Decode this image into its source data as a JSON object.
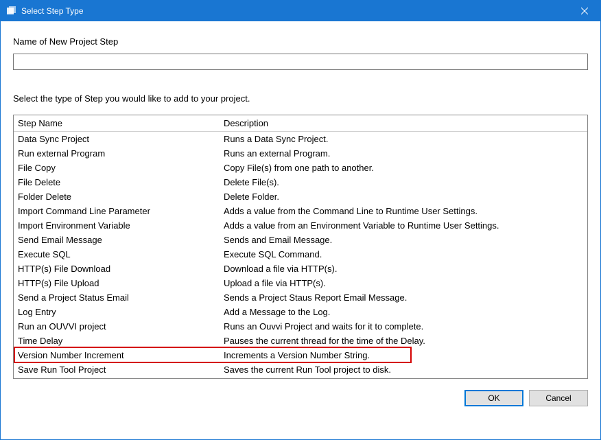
{
  "window": {
    "title": "Select Step Type"
  },
  "form": {
    "name_label": "Name of New Project Step",
    "name_value": "",
    "instruction": "Select the type of Step you would like to add to your project."
  },
  "columns": {
    "name": "Step Name",
    "description": "Description"
  },
  "steps": [
    {
      "name": "Data Sync Project",
      "desc": "Runs a Data Sync Project."
    },
    {
      "name": "Run external Program",
      "desc": "Runs an external Program."
    },
    {
      "name": "File Copy",
      "desc": "Copy File(s) from one path to another."
    },
    {
      "name": "File Delete",
      "desc": "Delete File(s)."
    },
    {
      "name": "Folder Delete",
      "desc": "Delete Folder."
    },
    {
      "name": "Import Command Line Parameter",
      "desc": "Adds a value from the Command Line to Runtime User Settings."
    },
    {
      "name": "Import Environment Variable",
      "desc": "Adds a value from an Environment Variable to Runtime User Settings."
    },
    {
      "name": "Send Email Message",
      "desc": "Sends and Email Message."
    },
    {
      "name": "Execute SQL",
      "desc": "Execute SQL Command."
    },
    {
      "name": "HTTP(s) File Download",
      "desc": "Download a file via HTTP(s)."
    },
    {
      "name": "HTTP(s) File Upload",
      "desc": "Upload a file via HTTP(s)."
    },
    {
      "name": "Send a Project Status Email",
      "desc": "Sends a Project Staus Report Email Message."
    },
    {
      "name": "Log Entry",
      "desc": "Add a Message to the Log."
    },
    {
      "name": "Run an OUVVI project",
      "desc": "Runs an Ouvvi Project and waits for it to complete."
    },
    {
      "name": "Time Delay",
      "desc": "Pauses the current thread for the time of the Delay."
    },
    {
      "name": "Version Number Increment",
      "desc": "Increments a Version Number String."
    },
    {
      "name": "Save Run Tool Project",
      "desc": "Saves the current Run Tool project to disk."
    }
  ],
  "highlighted_index": 15,
  "buttons": {
    "ok": "OK",
    "cancel": "Cancel"
  }
}
